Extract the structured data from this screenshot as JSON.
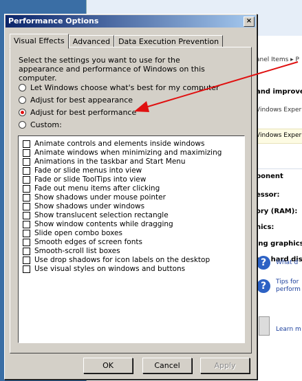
{
  "background_window": {
    "breadcrumb": "anel Items ▸ P",
    "heading": "and improve",
    "line1": "Vindows Experi",
    "highlight": "Vindows Exper",
    "rows": [
      "ponent",
      "essor:",
      "ory (RAM):",
      "hics:",
      "ing graphics:",
      "ary hard disk"
    ],
    "links": [
      "What d",
      "Tips for",
      "perform",
      "Learn m"
    ]
  },
  "dialog": {
    "title": "Performance Options",
    "close_label": "×",
    "tabs": [
      {
        "label": "Visual Effects",
        "active": true
      },
      {
        "label": "Advanced",
        "active": false
      },
      {
        "label": "Data Execution Prevention",
        "active": false
      }
    ],
    "description": "Select the settings you want to use for the appearance and performance of Windows on this computer.",
    "radios": [
      {
        "label": "Let Windows choose what's best for my computer",
        "selected": false
      },
      {
        "label": "Adjust for best appearance",
        "selected": false
      },
      {
        "label": "Adjust for best performance",
        "selected": true
      },
      {
        "label": "Custom:",
        "selected": false
      }
    ],
    "effects": [
      "Animate controls and elements inside windows",
      "Animate windows when minimizing and maximizing",
      "Animations in the taskbar and Start Menu",
      "Fade or slide menus into view",
      "Fade or slide ToolTips into view",
      "Fade out menu items after clicking",
      "Show shadows under mouse pointer",
      "Show shadows under windows",
      "Show translucent selection rectangle",
      "Show window contents while dragging",
      "Slide open combo boxes",
      "Smooth edges of screen fonts",
      "Smooth-scroll list boxes",
      "Use drop shadows for icon labels on the desktop",
      "Use visual styles on windows and buttons"
    ],
    "buttons": {
      "ok": "OK",
      "cancel": "Cancel",
      "apply": "Apply"
    }
  },
  "colors": {
    "arrow": "#e01010",
    "titlebar_start": "#0a246a",
    "titlebar_end": "#a6caf0"
  }
}
